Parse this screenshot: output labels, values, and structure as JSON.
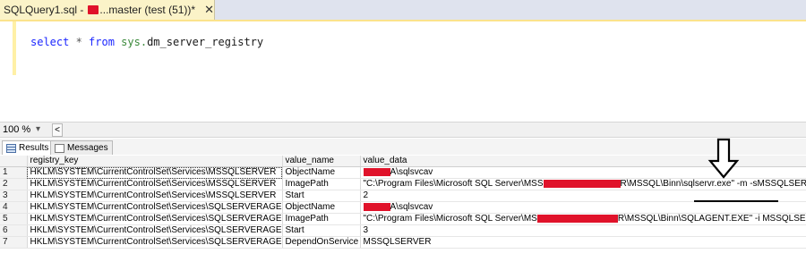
{
  "tab": {
    "title_prefix": "SQLQuery1.sql - ",
    "title_suffix": "...master (test (51))*",
    "close_glyph": "✕"
  },
  "editor": {
    "kw_select": "select",
    "star": " * ",
    "kw_from": "from",
    "sys": " sys.",
    "obj": "dm_server_registry"
  },
  "zoom": {
    "value": "100 %",
    "dropdown_glyph": "▾",
    "scroll_glyph": "<"
  },
  "result_tabs": {
    "results": "Results",
    "messages": "Messages"
  },
  "grid": {
    "columns": [
      "registry_key",
      "value_name",
      "value_data"
    ],
    "rows": [
      {
        "num": "1",
        "key": "HKLM\\SYSTEM\\CurrentControlSet\\Services\\MSSQLSERVER",
        "name": "ObjectName",
        "data_pre": "",
        "data_post": "A\\sqlsvcav"
      },
      {
        "num": "2",
        "key": "HKLM\\SYSTEM\\CurrentControlSet\\Services\\MSSQLSERVER",
        "name": "ImagePath",
        "data_pre": "\"C:\\Program Files\\Microsoft SQL Server\\MSS",
        "data_post": "R\\MSSQL\\Binn\\sqlservr.exe\" -m -sMSSQLSERVER"
      },
      {
        "num": "3",
        "key": "HKLM\\SYSTEM\\CurrentControlSet\\Services\\MSSQLSERVER",
        "name": "Start",
        "data_pre": "2",
        "data_post": ""
      },
      {
        "num": "4",
        "key": "HKLM\\SYSTEM\\CurrentControlSet\\Services\\SQLSERVERAGENT",
        "name": "ObjectName",
        "data_pre": "",
        "data_post": "A\\sqlsvcav"
      },
      {
        "num": "5",
        "key": "HKLM\\SYSTEM\\CurrentControlSet\\Services\\SQLSERVERAGENT",
        "name": "ImagePath",
        "data_pre": "\"C:\\Program Files\\Microsoft SQL Server\\MS",
        "data_post": "R\\MSSQL\\Binn\\SQLAGENT.EXE\" -i MSSQLSERVER"
      },
      {
        "num": "6",
        "key": "HKLM\\SYSTEM\\CurrentControlSet\\Services\\SQLSERVERAGENT",
        "name": "Start",
        "data_pre": "3",
        "data_post": ""
      },
      {
        "num": "7",
        "key": "HKLM\\SYSTEM\\CurrentControlSet\\Services\\SQLSERVERAGENT",
        "name": "DependOnService",
        "data_pre": "MSSQLSERVER",
        "data_post": ""
      }
    ]
  },
  "colors": {
    "redaction": "#e0122a",
    "tab_bg": "#fbf3c8",
    "keyword": "#1c27ff",
    "sys_schema": "#3b8a3b"
  }
}
